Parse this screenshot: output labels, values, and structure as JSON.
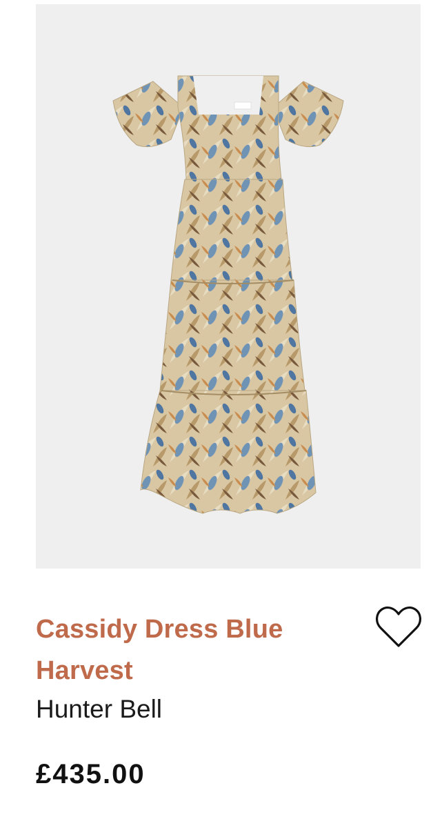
{
  "product": {
    "name": "Cassidy Dress Blue Harvest",
    "brand": "Hunter Bell",
    "price": "£435.00",
    "image_alt": "Cassidy Dress Blue Harvest"
  },
  "icons": {
    "wishlist": "heart-outline-icon"
  },
  "colors": {
    "title": "#c06a4c",
    "image_background": "#efefef",
    "text": "#1a1a1a"
  }
}
